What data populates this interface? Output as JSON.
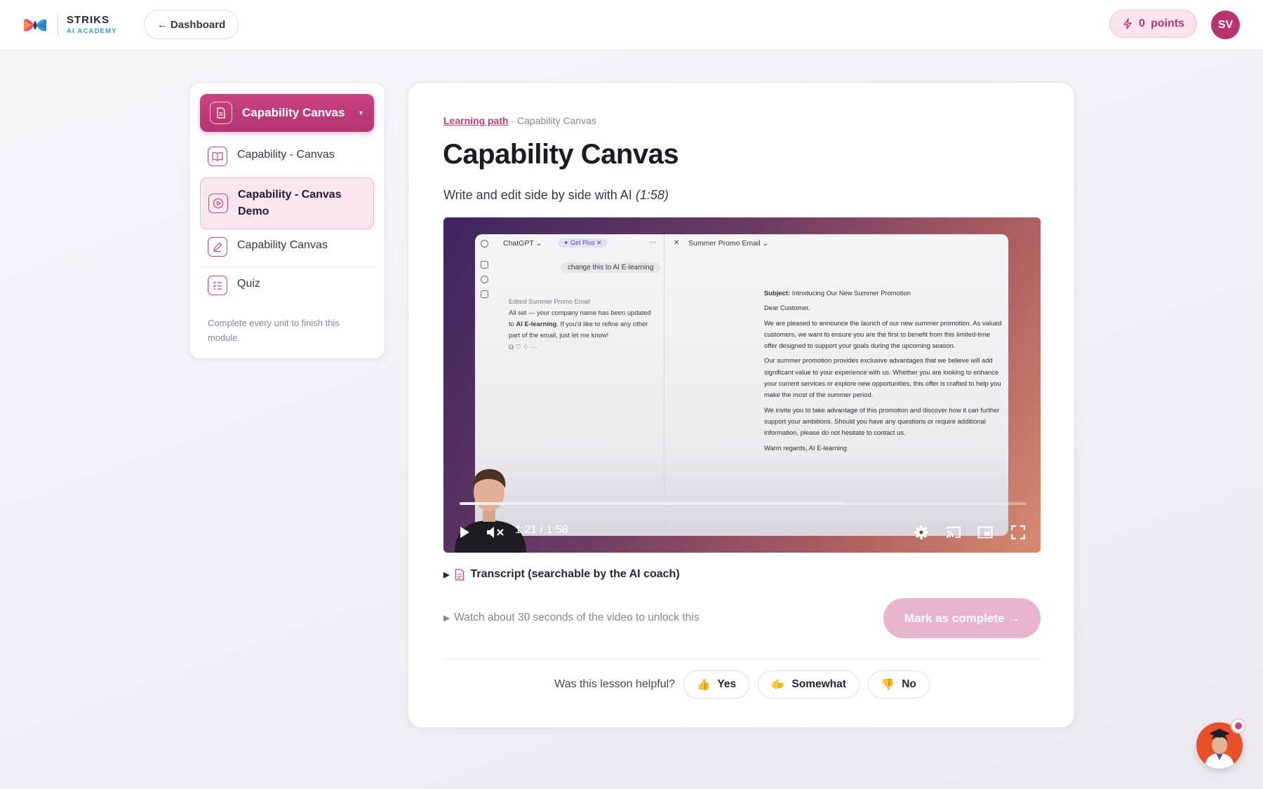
{
  "header": {
    "brand_name": "STRIKS",
    "brand_sub": "AI ACADEMY",
    "dashboard_label": "← Dashboard",
    "points_value": "0",
    "points_label": "points",
    "avatar_initials": "SV"
  },
  "sidebar": {
    "module_title": "Capability Canvas",
    "units": [
      {
        "label": "Capability - Canvas",
        "icon": "book-icon",
        "active": false
      },
      {
        "label": "Capability - Canvas Demo",
        "icon": "play-circle-icon",
        "active": true
      },
      {
        "label": "Capability Canvas",
        "icon": "pencil-icon",
        "active": false
      },
      {
        "label": "Quiz",
        "icon": "checklist-icon",
        "active": false
      }
    ],
    "note": "Complete every unit to finish this module."
  },
  "main": {
    "breadcrumb_link": "Learning path",
    "breadcrumb_sep": " · ",
    "breadcrumb_current": "Capability Canvas",
    "title": "Capability Canvas",
    "subtitle": "Write and edit side by side with AI",
    "duration": "(1:58)",
    "transcript_label": "Transcript (searchable by the AI coach)",
    "unlock_text": "Watch about 30 seconds of the video to unlock this",
    "mark_complete_label": "Mark as complete →",
    "helpful_question": "Was this lesson helpful?",
    "feedback": [
      {
        "emoji": "👍",
        "label": "Yes"
      },
      {
        "emoji": "🫱",
        "label": "Somewhat"
      },
      {
        "emoji": "👎",
        "label": "No"
      }
    ]
  },
  "video": {
    "current_time": "1:21",
    "separator": " / ",
    "total_time": "1:58",
    "progress": 0.68,
    "chat_app": "ChatGPT ⌄",
    "get_plus": "✦ Get Plus ✕",
    "menu_dots": "···",
    "user_prompt": "change this to AI E-learning",
    "edited_label": "Edited Summer Promo Email",
    "reply_line1": "All set — your company name has been updated",
    "reply_line2_prefix": "to ",
    "reply_line2_bold": "AI E-learning",
    "reply_line2_suffix": ". If you'd like to refine any other",
    "reply_line3": "part of the email, just let me know!",
    "doc_close": "✕",
    "doc_title": "Summer Promo Email ⌄",
    "email_subject_label": "Subject:",
    "email_subject": " Introducing Our New Summer Promotion",
    "email_greeting": "Dear Customer,",
    "email_p1": "We are pleased to announce the launch of our new summer promotion. As valued customers, we want to ensure you are the first to benefit from this limited-time offer designed to support your goals during the upcoming season.",
    "email_p2": "Our summer promotion provides exclusive advantages that we believe will add significant value to your experience with us. Whether you are looking to enhance your current services or explore new opportunities, this offer is crafted to help you make the most of the summer period.",
    "email_p3": "We invite you to take advantage of this promotion and discover how it can further support your ambitions. Should you have any questions or require additional information, please do not hesitate to contact us.",
    "email_sign": "Warm regards, AI E-learning"
  },
  "colors": {
    "accent": "#c03e7a",
    "accent_light": "#f9e6ef",
    "brand_teal": "#2ba7b8"
  }
}
